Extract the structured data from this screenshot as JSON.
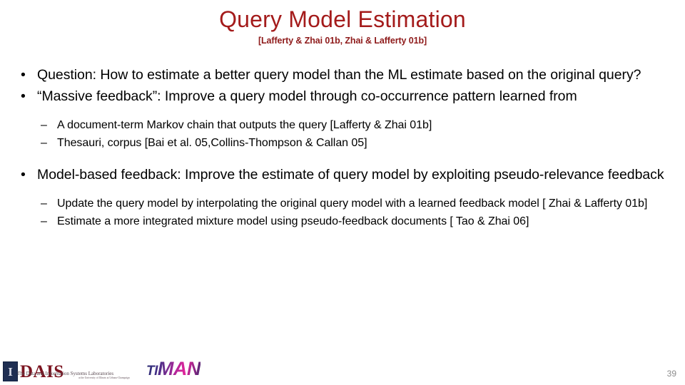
{
  "slide": {
    "title": "Query Model Estimation",
    "subtitle": "[Lafferty & Zhai 01b, Zhai & Lafferty 01b]",
    "title_color": "#A41B1B",
    "subtitle_color": "#8E1A1A",
    "background_color": "#FFFFFF"
  },
  "bullet_marker": "•",
  "dash_marker": "–",
  "content": {
    "group1": {
      "bullets": [
        "Question: How to estimate a better query model than the ML estimate based on the original query?",
        "“Massive feedback”: Improve a query model through co-occurrence pattern learned from"
      ],
      "sub_bullets": [
        "A document-term Markov chain that outputs the query [Lafferty & Zhai 01b]",
        "Thesauri, corpus [Bai et al. 05,Collins-Thompson & Callan 05]"
      ]
    },
    "group2": {
      "bullets": [
        "Model-based feedback: Improve the estimate of query model by exploiting pseudo-relevance feedback"
      ],
      "sub_bullets": [
        "Update the query model by interpolating the original query model with a learned feedback model [ Zhai & Lafferty 01b]",
        "Estimate a more integrated mixture model using pseudo-feedback documents  [ Tao & Zhai 06]"
      ]
    }
  },
  "footer": {
    "dais_logo": {
      "mark_letter": "I",
      "wordmark": "DAIS",
      "tagline_line1": "The Data and Information Systems Laboratories",
      "tagline_line2": "at the University of Illinois at Urbana-Champaign"
    },
    "timan_logo": {
      "part_t": "T",
      "part_i": "I",
      "part_m": "M",
      "part_a": "A",
      "part_n": "N"
    },
    "page_number": "39"
  }
}
